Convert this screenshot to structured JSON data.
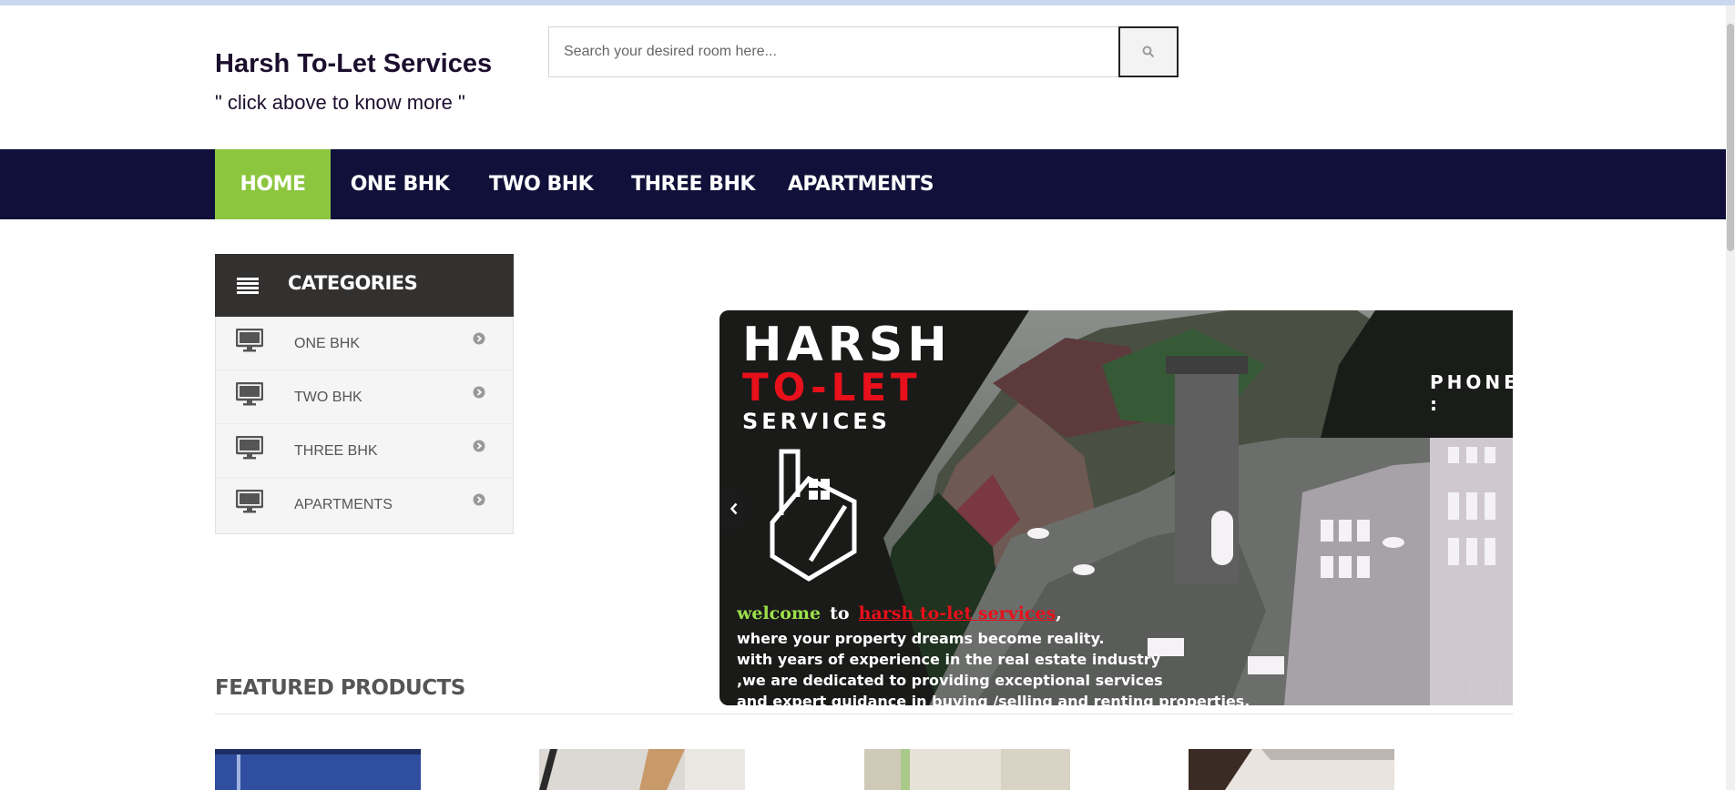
{
  "site": {
    "title": "Harsh To-Let Services",
    "tagline": "\" click above to know more \""
  },
  "search": {
    "placeholder": "Search your desired room here...",
    "icon": "search-icon"
  },
  "nav": {
    "items": [
      {
        "label": "HOME",
        "active": true
      },
      {
        "label": "ONE BHK"
      },
      {
        "label": "TWO BHK"
      },
      {
        "label": "THREE BHK"
      },
      {
        "label": "APARTMENTS"
      }
    ]
  },
  "categories": {
    "title": "CATEGORIES",
    "icon": "list-icon",
    "items": [
      {
        "label": "ONE BHK",
        "icon": "monitor-icon"
      },
      {
        "label": "TWO BHK",
        "icon": "monitor-icon"
      },
      {
        "label": "THREE BHK",
        "icon": "monitor-icon"
      },
      {
        "label": "APARTMENTS",
        "icon": "monitor-icon"
      }
    ]
  },
  "slider": {
    "logo_line1": "HARSH",
    "logo_line2": "TO-LET",
    "logo_line3": "SERVICES",
    "phone_partial": "PHONE :",
    "welcome_word": "welcome",
    "to_word": "to",
    "brand_link": "harsh to-let services",
    "brand_suffix": ",",
    "lines": [
      "where your property dreams become reality.",
      "with years of experience in the real estate industry",
      ",we are dedicated to providing exceptional services",
      "and expert guidance in buying /selling and renting properties."
    ]
  },
  "featured": {
    "title": "FEATURED PRODUCTS"
  },
  "colors": {
    "nav_bg": "#10103a",
    "nav_active": "#8cc63f",
    "category_header": "#333130",
    "title_color": "#1c0f2e"
  }
}
